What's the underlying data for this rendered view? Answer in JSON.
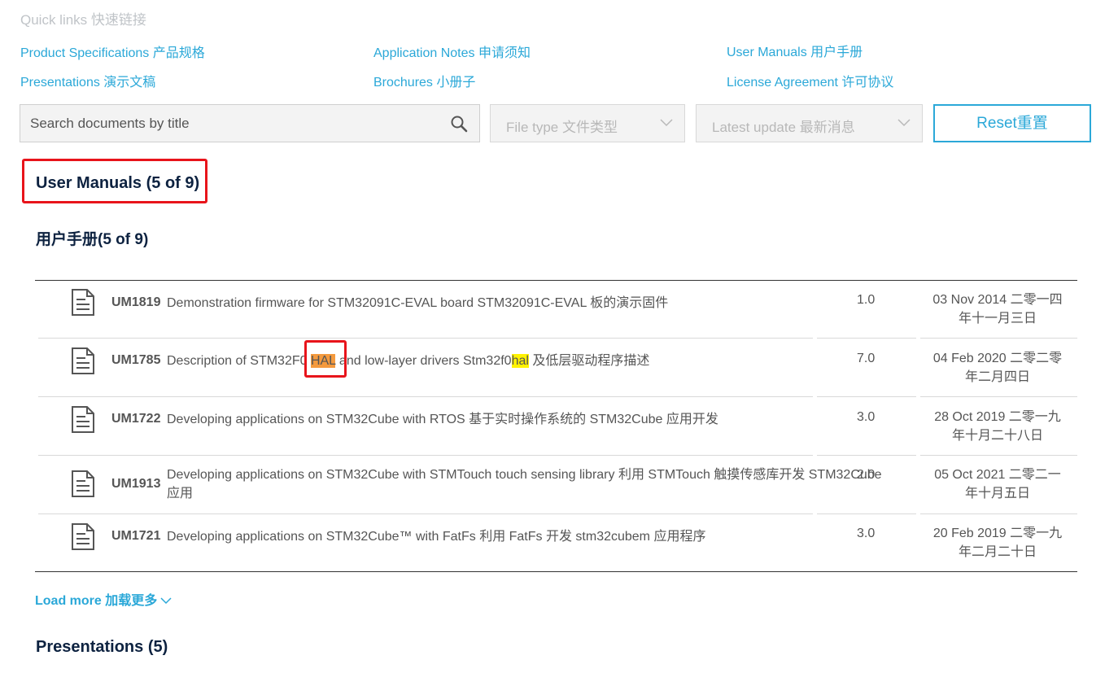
{
  "quick_links": {
    "title": "Quick links 快速链接",
    "items": [
      "Product Specifications 产品规格",
      "Application Notes 申请须知",
      "User Manuals 用户手册",
      "Presentations 演示文稿",
      "Brochures 小册子",
      "License Agreement 许可协议"
    ]
  },
  "filters": {
    "search_placeholder": "Search documents by title",
    "file_type": "File type 文件类型",
    "latest_update": "Latest update 最新消息",
    "reset": "Reset重置"
  },
  "user_manuals": {
    "heading": "User Manuals (5 of 9)",
    "subheading": "用户手册(5 of 9)",
    "rows": [
      {
        "code": "UM1819",
        "title": "Demonstration firmware for STM32091C-EVAL board STM32091C-EVAL 板的演示固件",
        "version": "1.0",
        "date_line1": "03 Nov 2014 二零一四",
        "date_line2": "年十一月三日"
      },
      {
        "code": "UM1785",
        "title_before": "Description of STM32F0 ",
        "title_hl1": "HAL",
        "title_mid": " and low-layer drivers Stm32f0",
        "title_hl2": "hal",
        "title_after": " 及低层驱动程序描述",
        "version": "7.0",
        "date_line1": "04 Feb 2020 二零二零",
        "date_line2": "年二月四日"
      },
      {
        "code": "UM1722",
        "title": "Developing applications on STM32Cube with RTOS 基于实时操作系统的 STM32Cube 应用开发",
        "version": "3.0",
        "date_line1": "28 Oct 2019 二零一九",
        "date_line2": "年十月二十八日"
      },
      {
        "code": "UM1913",
        "title_line1": "Developing applications on STM32Cube with STMTouch touch sensing library 利用 STMTouch 触摸传感库开发 STM32Cube",
        "title_line2": "应用",
        "version": "2.0",
        "date_line1": "05 Oct 2021 二零二一",
        "date_line2": "年十月五日"
      },
      {
        "code": "UM1721",
        "title": "Developing applications on STM32Cube™ with FatFs 利用 FatFs 开发 stm32cubem 应用程序",
        "version": "3.0",
        "date_line1": "20 Feb 2019 二零一九",
        "date_line2": "年二月二十日"
      }
    ],
    "load_more": "Load more 加载更多"
  },
  "presentations": {
    "heading": "Presentations (5)"
  },
  "colors": {
    "link": "#2ba8d8",
    "heading": "#0d2240",
    "annotation": "#e8141b",
    "highlight_orange": "#f49a3e",
    "highlight_yellow": "#fff200"
  }
}
